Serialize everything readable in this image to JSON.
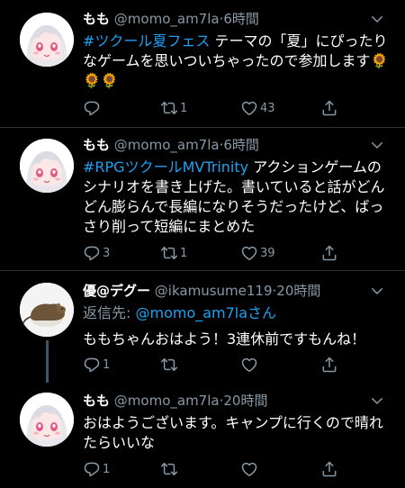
{
  "tweets": [
    {
      "name": "もも",
      "handle": "@momo_am7la",
      "sep": "·",
      "time": "6時間",
      "hashtag": "#ツクール夏フェス",
      "text": " テーマの「夏」にぴったりなゲームを思いついちゃったので参加します",
      "emoji": "🌻🌻🌻",
      "reply_count": "",
      "retweet_count": "1",
      "like_count": "43"
    },
    {
      "name": "もも",
      "handle": "@momo_am7la",
      "sep": "·",
      "time": "6時間",
      "hashtag": "#RPGツクールMVTrinity",
      "text": " アクションゲームのシナリオを書き上げた。書いていると話がどんどん膨らんで長編になりそうだったけど、ばっさり削って短編にまとめた",
      "reply_count": "3",
      "retweet_count": "1",
      "like_count": "39"
    },
    {
      "name": "優@デグー",
      "handle": "@ikamusume119",
      "sep": "·",
      "time": "20時間",
      "reply_prefix": "返信先: ",
      "reply_target": "@momo_am7laさん",
      "text": "ももちゃんおはよう！3連休前ですもんね！",
      "reply_count": "1",
      "retweet_count": "",
      "like_count": ""
    },
    {
      "name": "もも",
      "handle": "@momo_am7la",
      "sep": "·",
      "time": "20時間",
      "text": "おはようございます。キャンプに行くので晴れたらいいな",
      "reply_count": "1",
      "retweet_count": "",
      "like_count": ""
    }
  ],
  "colors": {
    "background": "#000000",
    "link": "#1da1f2",
    "secondary_text": "#8899a6",
    "divider": "#2f3336"
  },
  "icons": [
    "reply-icon",
    "retweet-icon",
    "like-icon",
    "share-icon",
    "chevron-down-icon"
  ]
}
